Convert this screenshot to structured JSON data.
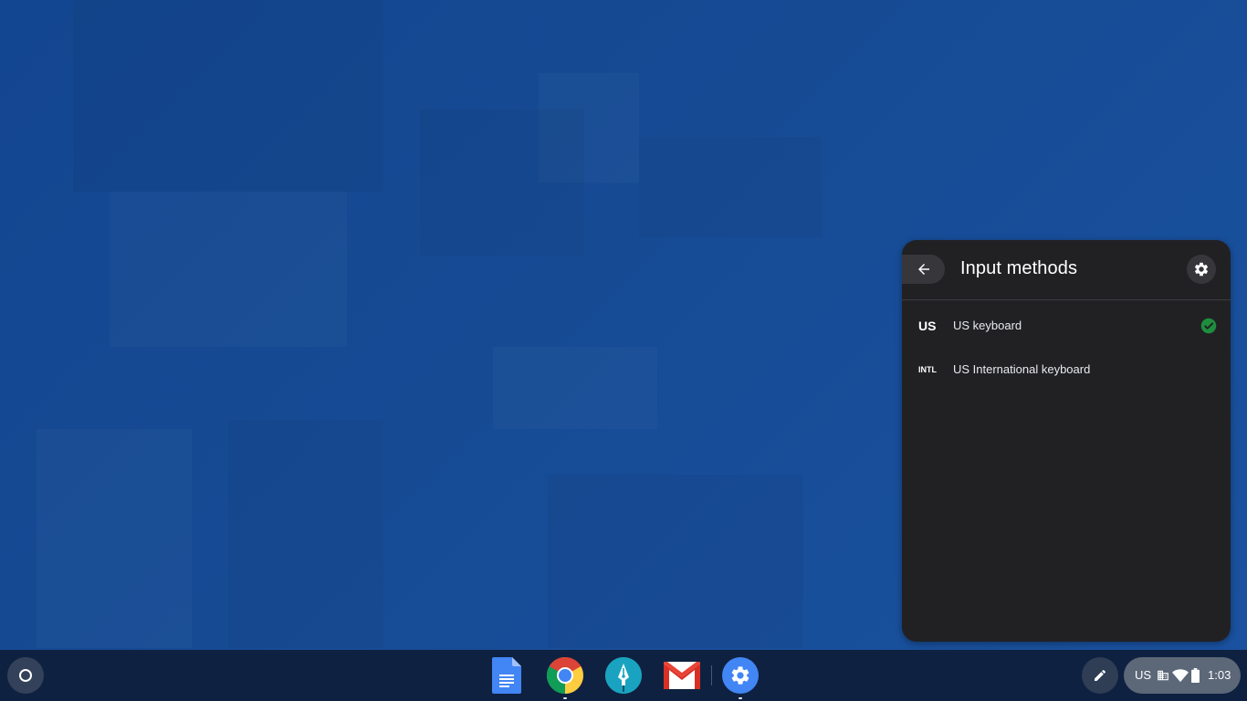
{
  "panel": {
    "title": "Input methods",
    "back_icon": "arrow-back-icon",
    "settings_icon": "gear-icon",
    "methods": [
      {
        "short": "US",
        "label": "US keyboard",
        "selected": true
      },
      {
        "short": "INTL",
        "label": "US International keyboard",
        "selected": false
      }
    ],
    "selected_color": "#1e8e3e"
  },
  "shelf": {
    "launcher_icon": "launcher-circle-icon",
    "apps": [
      {
        "name": "Google Docs",
        "icon": "docs-icon",
        "running": false
      },
      {
        "name": "Google Chrome",
        "icon": "chrome-icon",
        "running": true
      },
      {
        "name": "Pen app",
        "icon": "pen-app-icon",
        "running": false
      },
      {
        "name": "Gmail",
        "icon": "gmail-icon",
        "running": false
      },
      {
        "name": "Settings",
        "icon": "settings-app-icon",
        "running": true
      }
    ],
    "stylus_icon": "stylus-icon",
    "status": {
      "ime": "US",
      "icons": [
        "enterprise-icon",
        "wifi-icon",
        "battery-icon"
      ],
      "time": "1:03"
    }
  },
  "colors": {
    "wallpaper": "#154b95",
    "panel_bg": "#212124",
    "shelf_bg": "#0f2140"
  }
}
